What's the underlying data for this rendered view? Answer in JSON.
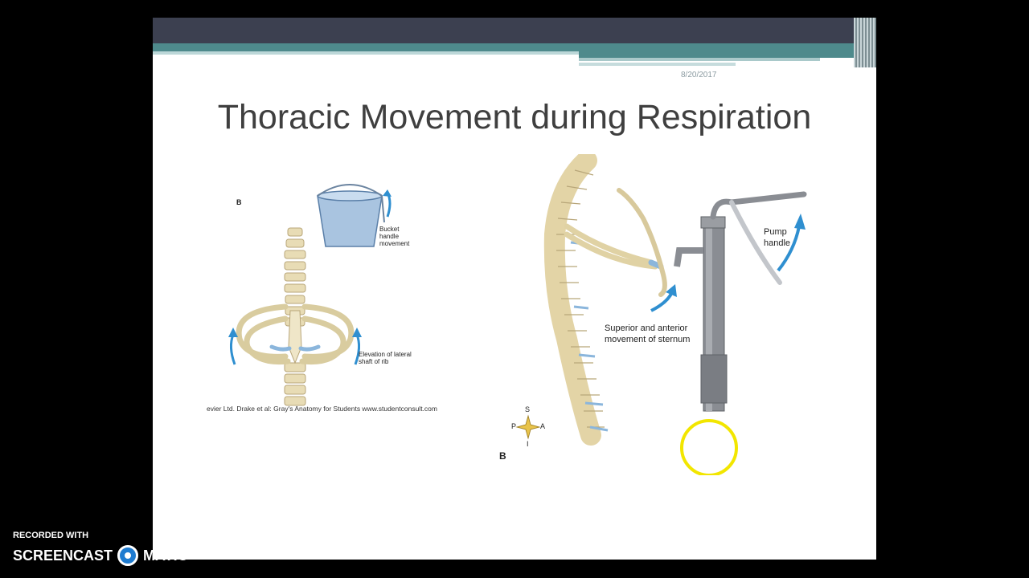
{
  "slide": {
    "date": "8/20/2017",
    "title": "Thoracic Movement during Respiration"
  },
  "figure_left": {
    "panel_label": "B",
    "bucket_label": "Bucket handle movement",
    "bucket_label_lines": [
      "Bucket",
      "handle",
      "movement"
    ],
    "rib_label_lines": [
      "Elevation of lateral",
      "shaft of rib"
    ],
    "credit": "evier Ltd. Drake et al: Gray's Anatomy for Students www.studentconsult.com"
  },
  "figure_right": {
    "panel_label": "B",
    "pump_label_lines": [
      "Pump",
      "handle"
    ],
    "sternum_label_lines": [
      "Superior and anterior",
      "movement of sternum"
    ],
    "compass": {
      "s": "S",
      "p": "P",
      "a": "A",
      "i": "I"
    }
  },
  "watermark": {
    "recorded_with": "RECORDED WITH",
    "brand_left": "SCREENCAST",
    "brand_right": "MATIC"
  },
  "colors": {
    "header_dark": "#3c4050",
    "header_teal": "#4e8a8c",
    "bone": "#e8dcb5",
    "cartilage": "#8bb6dc",
    "arrow_blue": "#2f8fd0",
    "cursor_ring": "#f2e600"
  }
}
